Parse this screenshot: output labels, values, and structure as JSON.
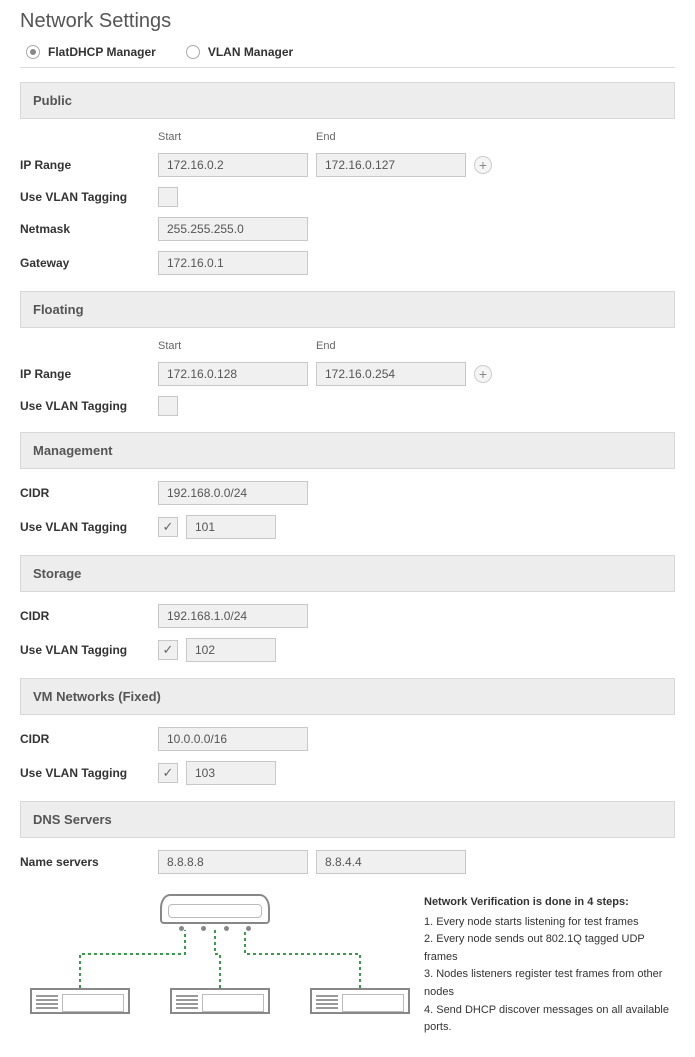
{
  "title": "Network Settings",
  "radios": {
    "flatdhcp": "FlatDHCP Manager",
    "vlan": "VLAN Manager"
  },
  "col_labels": {
    "start": "Start",
    "end": "End"
  },
  "public": {
    "header": "Public",
    "ip_range_label": "IP Range",
    "ip_start": "172.16.0.2",
    "ip_end": "172.16.0.127",
    "use_vlan_label": "Use VLAN Tagging",
    "netmask_label": "Netmask",
    "netmask": "255.255.255.0",
    "gateway_label": "Gateway",
    "gateway": "172.16.0.1"
  },
  "floating": {
    "header": "Floating",
    "ip_range_label": "IP Range",
    "ip_start": "172.16.0.128",
    "ip_end": "172.16.0.254",
    "use_vlan_label": "Use VLAN Tagging"
  },
  "management": {
    "header": "Management",
    "cidr_label": "CIDR",
    "cidr": "192.168.0.0/24",
    "use_vlan_label": "Use VLAN Tagging",
    "vlan_id": "101"
  },
  "storage": {
    "header": "Storage",
    "cidr_label": "CIDR",
    "cidr": "192.168.1.0/24",
    "use_vlan_label": "Use VLAN Tagging",
    "vlan_id": "102"
  },
  "vmnet": {
    "header": "VM Networks (Fixed)",
    "cidr_label": "CIDR",
    "cidr": "10.0.0.0/16",
    "use_vlan_label": "Use VLAN Tagging",
    "vlan_id": "103"
  },
  "dns": {
    "header": "DNS Servers",
    "name_label": "Name servers",
    "ns1": "8.8.8.8",
    "ns2": "8.8.4.4"
  },
  "verify": {
    "heading": "Network Verification is done in 4 steps:",
    "step1": "1. Every node starts listening for test frames",
    "step2": "2. Every node sends out 802.1Q tagged UDP frames",
    "step3": "3. Nodes listeners register test frames from other nodes",
    "step4": "4. Send DHCP discover messages on all available ports."
  }
}
